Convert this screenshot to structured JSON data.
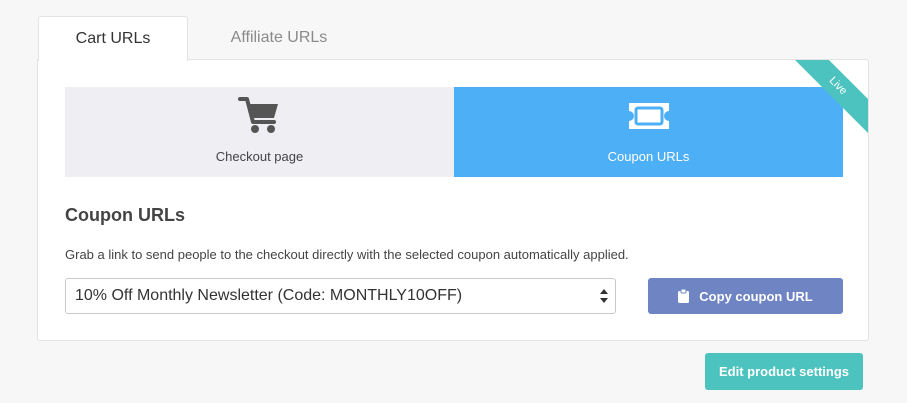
{
  "tabs": [
    {
      "label": "Cart URLs",
      "active": true
    },
    {
      "label": "Affiliate URLs",
      "active": false
    }
  ],
  "options": [
    {
      "label": "Checkout page",
      "icon": "cart-icon",
      "selected": false
    },
    {
      "label": "Coupon URLs",
      "icon": "ticket-icon",
      "selected": true
    }
  ],
  "ribbon": {
    "label": "Live",
    "color": "#4cc3be"
  },
  "section": {
    "title": "Coupon URLs",
    "description": "Grab a link to send people to the checkout directly with the selected coupon automatically applied."
  },
  "coupon_select": {
    "value": "10% Off Monthly Newsletter (Code: MONTHLY10OFF)"
  },
  "copy_button": {
    "label": "Copy coupon URL",
    "icon": "clipboard-icon",
    "color": "#6f84c2"
  },
  "edit_button": {
    "label": "Edit product settings",
    "color": "#4cc3be"
  },
  "colors": {
    "accent": "#4daff5",
    "option_bg": "#eeeef3"
  }
}
